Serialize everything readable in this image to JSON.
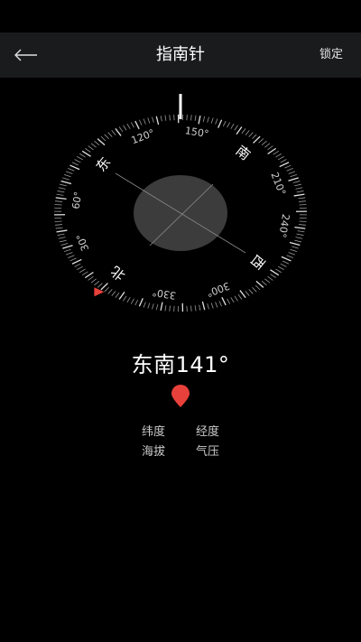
{
  "app_bar": {
    "title": "指南针",
    "lock_label": "锁定",
    "back_icon": "back-arrow-icon"
  },
  "compass": {
    "heading_degrees": 141,
    "dial_rotation_degrees": -141,
    "cardinal_labels": [
      {
        "text": "北",
        "bearing": 0
      },
      {
        "text": "东",
        "bearing": 90
      },
      {
        "text": "南",
        "bearing": 180
      },
      {
        "text": "西",
        "bearing": 270
      }
    ],
    "degree_labels": [
      {
        "text": "30°",
        "bearing": 30
      },
      {
        "text": "60°",
        "bearing": 60
      },
      {
        "text": "120°",
        "bearing": 120
      },
      {
        "text": "150°",
        "bearing": 150
      },
      {
        "text": "210°",
        "bearing": 210
      },
      {
        "text": "240°",
        "bearing": 240
      },
      {
        "text": "300°",
        "bearing": 300
      },
      {
        "text": "330°",
        "bearing": 330
      }
    ],
    "north_marker_color": "#e8413b",
    "bubble_color": "#3c3c3c"
  },
  "heading_text": "东南141°",
  "location_icon": "location-pin-icon",
  "location_icon_color": "#e8413b",
  "info": {
    "latitude_label": "纬度",
    "longitude_label": "经度",
    "altitude_label": "海拔",
    "pressure_label": "气压"
  }
}
